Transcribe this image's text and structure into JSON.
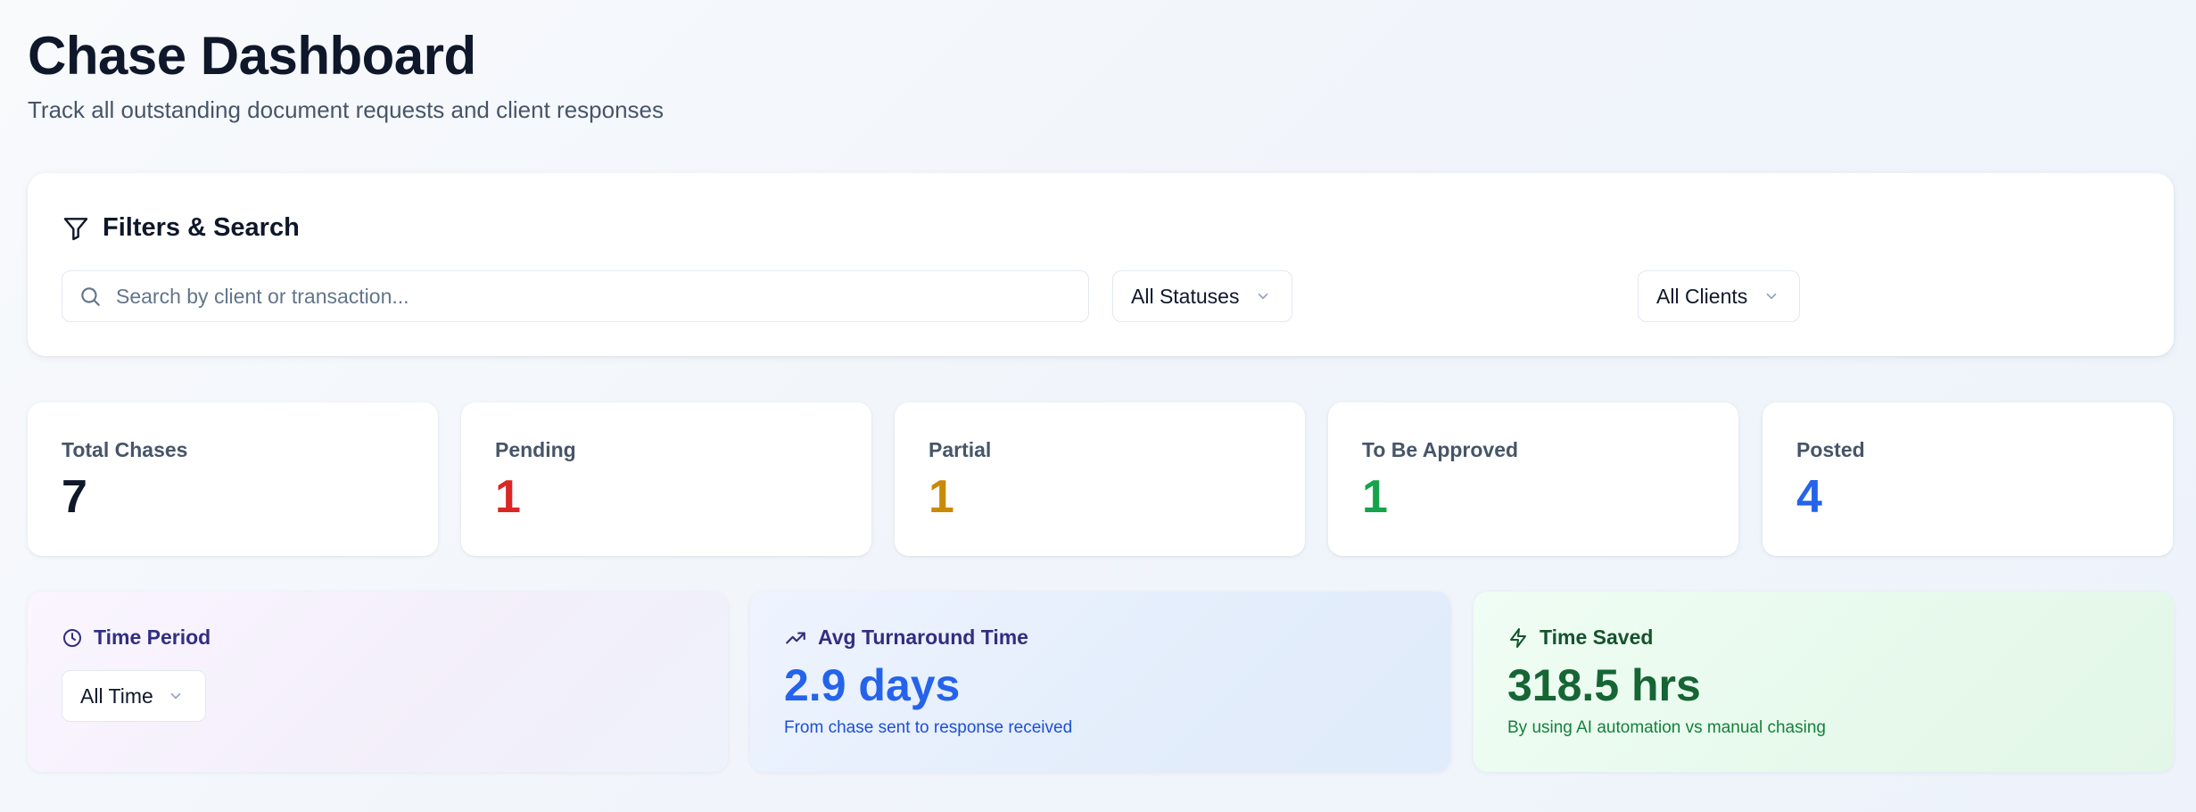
{
  "header": {
    "title": "Chase Dashboard",
    "subtitle": "Track all outstanding document requests and client responses"
  },
  "filters": {
    "title": "Filters & Search",
    "search_placeholder": "Search by client or transaction...",
    "status_select": "All Statuses",
    "client_select": "All Clients"
  },
  "stats": [
    {
      "label": "Total Chases",
      "value": "7",
      "color": "#0f172a"
    },
    {
      "label": "Pending",
      "value": "1",
      "color": "#dc2626"
    },
    {
      "label": "Partial",
      "value": "1",
      "color": "#ca8a04"
    },
    {
      "label": "To Be Approved",
      "value": "1",
      "color": "#16a34a"
    },
    {
      "label": "Posted",
      "value": "4",
      "color": "#2563eb"
    }
  ],
  "metrics": {
    "time_period": {
      "label": "Time Period",
      "select": "All Time",
      "icon": "clock-icon"
    },
    "avg_turnaround": {
      "label": "Avg Turnaround Time",
      "value": "2.9 days",
      "note": "From chase sent to response received",
      "icon": "trending-up-icon",
      "color": "#2563eb"
    },
    "time_saved": {
      "label": "Time Saved",
      "value": "318.5 hrs",
      "note": "By using AI automation vs manual chasing",
      "icon": "lightning-icon",
      "color": "#166534"
    }
  }
}
